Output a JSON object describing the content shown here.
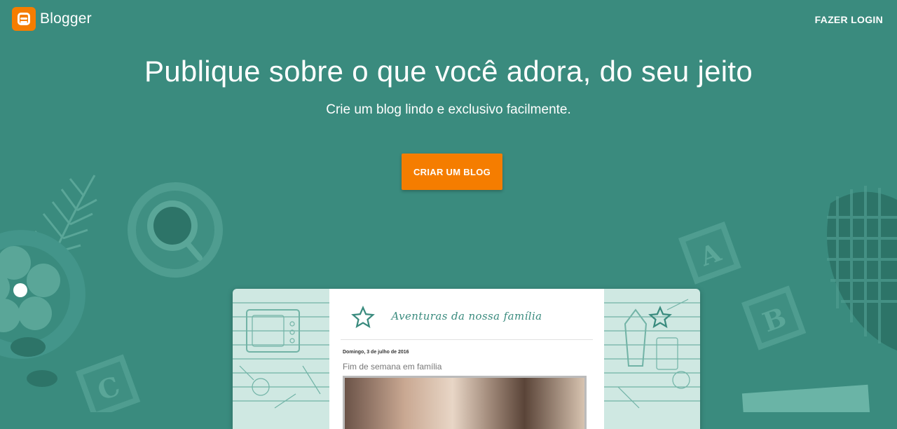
{
  "header": {
    "brand": "Blogger",
    "logo_icon": "blogger-logo-icon",
    "login_label": "FAZER LOGIN"
  },
  "hero": {
    "title": "Publique sobre o que você adora, do seu jeito",
    "subtitle": "Crie um blog lindo e exclusivo facilmente.",
    "cta_label": "CRIAR UM BLOG"
  },
  "preview": {
    "blog_title": "Aventuras da nossa família",
    "post_date": "Domingo, 3 de julho de 2016",
    "post_heading": "Fim de semana em família"
  },
  "colors": {
    "background": "#3a8b7e",
    "accent": "#f57d00"
  }
}
